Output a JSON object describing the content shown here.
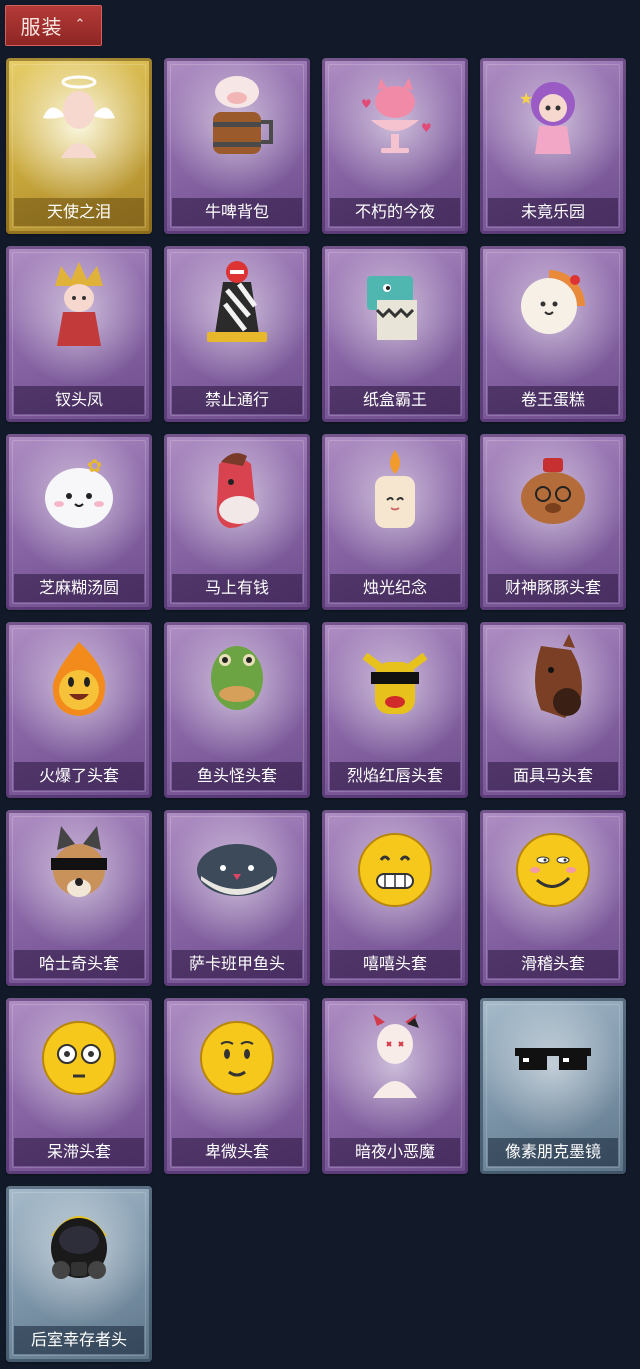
{
  "section": {
    "label": "服装",
    "chevron": "⌃",
    "icon": "chevron-up-icon"
  },
  "items": [
    {
      "label": "天使之泪",
      "frame": "gold",
      "icon": "angel-icon"
    },
    {
      "label": "牛啤背包",
      "frame": "purple",
      "icon": "beer-barrel-cow-icon"
    },
    {
      "label": "不朽的今夜",
      "frame": "purple",
      "icon": "pink-cat-cup-icon"
    },
    {
      "label": "未竟乐园",
      "frame": "purple",
      "icon": "purple-hair-doll-icon"
    },
    {
      "label": "钗头凤",
      "frame": "purple",
      "icon": "phoenix-crown-doll-icon"
    },
    {
      "label": "禁止通行",
      "frame": "purple",
      "icon": "traffic-barrier-icon"
    },
    {
      "label": "纸盒霸王",
      "frame": "purple",
      "icon": "box-dinosaur-icon"
    },
    {
      "label": "卷王蛋糕",
      "frame": "purple",
      "icon": "swiss-roll-cake-icon"
    },
    {
      "label": "芝麻糊汤圆",
      "frame": "purple",
      "icon": "rice-ball-icon"
    },
    {
      "label": "马上有钱",
      "frame": "purple",
      "icon": "red-horse-head-icon"
    },
    {
      "label": "烛光纪念",
      "frame": "purple",
      "icon": "candle-icon"
    },
    {
      "label": "财神豚豚头套",
      "frame": "purple",
      "icon": "capybara-head-icon"
    },
    {
      "label": "火爆了头套",
      "frame": "purple",
      "icon": "fire-head-icon"
    },
    {
      "label": "鱼头怪头套",
      "frame": "purple",
      "icon": "fish-head-icon"
    },
    {
      "label": "烈焰红唇头套",
      "frame": "purple",
      "icon": "yellow-mask-sunglasses-icon"
    },
    {
      "label": "面具马头套",
      "frame": "purple",
      "icon": "horse-mask-icon"
    },
    {
      "label": "哈士奇头套",
      "frame": "purple",
      "icon": "husky-head-icon"
    },
    {
      "label": "萨卡班甲鱼头",
      "frame": "purple",
      "icon": "fish-fish-head-icon"
    },
    {
      "label": "嘻嘻头套",
      "frame": "purple",
      "icon": "grin-emoji-head-icon"
    },
    {
      "label": "滑稽头套",
      "frame": "purple",
      "icon": "smirk-emoji-head-icon"
    },
    {
      "label": "呆滞头套",
      "frame": "purple",
      "icon": "stunned-emoji-head-icon"
    },
    {
      "label": "卑微头套",
      "frame": "purple",
      "icon": "humble-emoji-head-icon"
    },
    {
      "label": "暗夜小恶魔",
      "frame": "purple",
      "icon": "little-devil-icon"
    },
    {
      "label": "像素朋克墨镜",
      "frame": "blue",
      "icon": "pixel-sunglasses-icon"
    },
    {
      "label": "后室幸存者头",
      "frame": "blue",
      "icon": "gas-mask-helmet-icon"
    }
  ]
}
